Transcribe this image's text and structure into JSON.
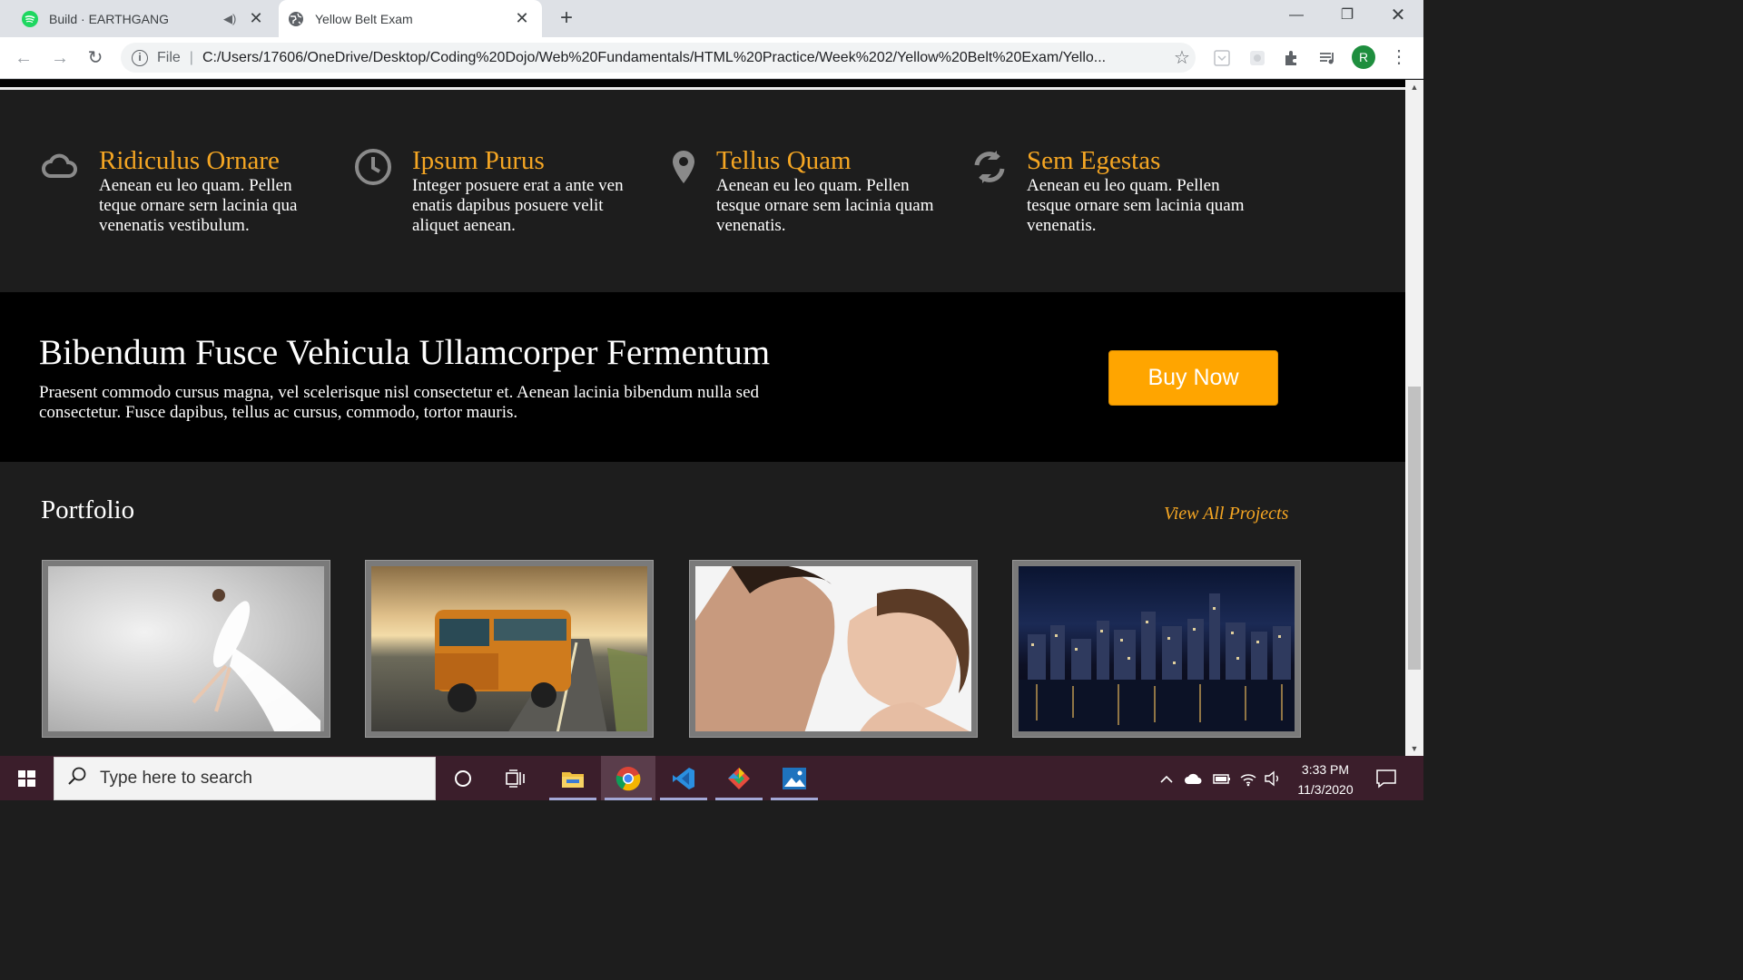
{
  "browser": {
    "tabs": [
      {
        "title": "Build · EARTHGANG",
        "active": false
      },
      {
        "title": "Yellow Belt Exam",
        "active": true
      }
    ],
    "address": {
      "scheme": "File",
      "url": "C:/Users/17606/OneDrive/Desktop/Coding%20Dojo/Web%20Fundamentals/HTML%20Practice/Week%202/Yellow%20Belt%20Exam/Yello..."
    },
    "profile_initial": "R"
  },
  "page": {
    "features": [
      {
        "icon": "cloud-icon",
        "title": "Ridiculus Ornare",
        "text": "Aenean eu leo quam. Pellen teque ornare sern lacinia qua venenatis vestibulum."
      },
      {
        "icon": "clock-icon",
        "title": "Ipsum Purus",
        "text": "Integer posuere erat a ante ven enatis dapibus posuere velit aliquet aenean."
      },
      {
        "icon": "map-marker-icon",
        "title": "Tellus Quam",
        "text": "Aenean eu leo quam. Pellen tesque ornare sem lacinia quam venenatis."
      },
      {
        "icon": "refresh-icon",
        "title": "Sem Egestas",
        "text": "Aenean eu leo quam. Pellen tesque ornare sem lacinia quam venenatis."
      }
    ],
    "cta": {
      "heading": "Bibendum Fusce Vehicula Ullamcorper Fermentum",
      "text": "Praesent commodo cursus magna, vel scelerisque nisl consectetur et. Aenean lacinia bibendum nulla sed consectetur. Fusce dapibus, tellus ac cursus, commodo, tortor mauris.",
      "button": "Buy Now"
    },
    "portfolio": {
      "title": "Portfolio",
      "view_all": "View All Projects",
      "items": [
        "dancer-photo",
        "bus-photo",
        "couple-photo",
        "city-night-photo"
      ]
    },
    "colors": {
      "accent": "#f5a623",
      "button": "#ffa500",
      "background": "#1d1d1d",
      "cta_bg": "#000000"
    }
  },
  "taskbar": {
    "search_placeholder": "Type here to search",
    "time": "3:33 PM",
    "date": "11/3/2020"
  }
}
